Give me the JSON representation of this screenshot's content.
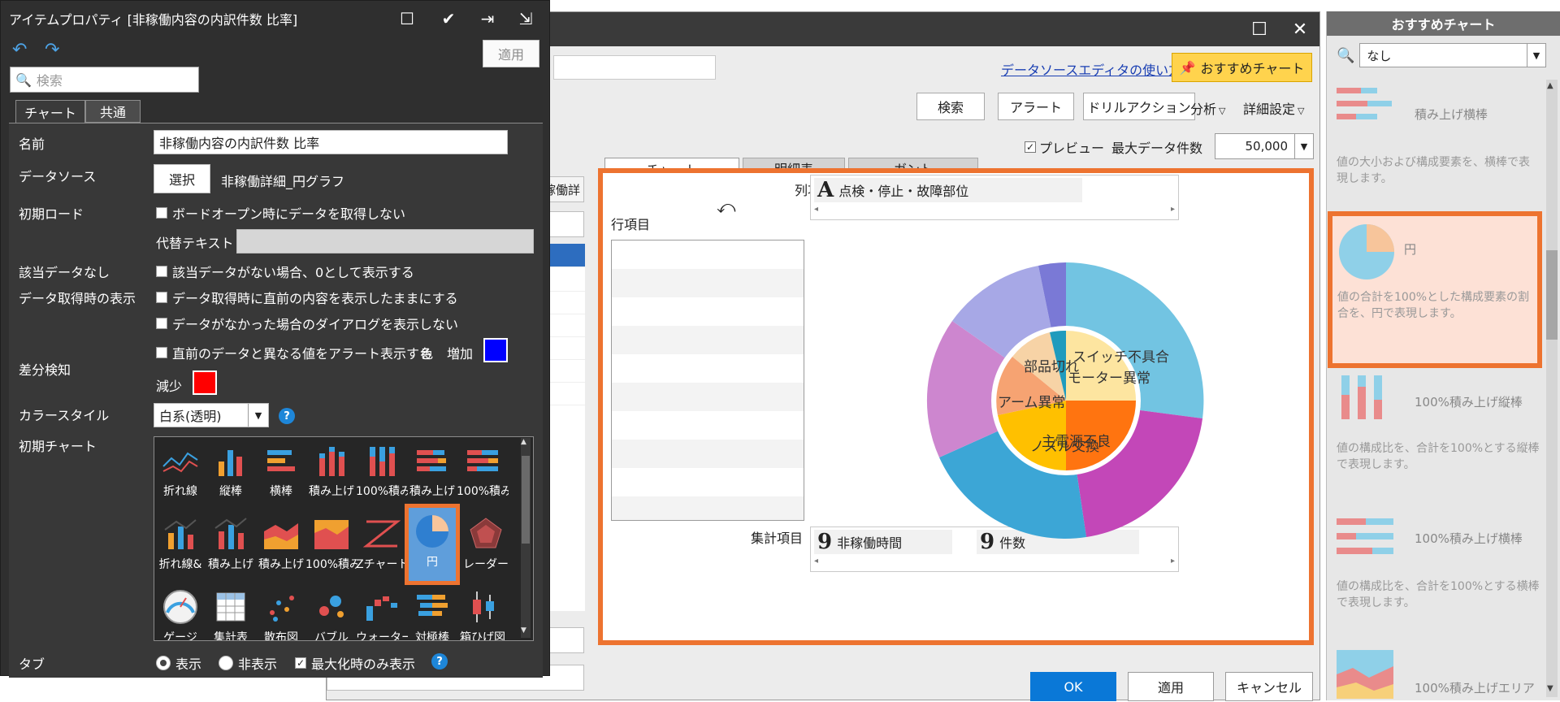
{
  "editor": {
    "help_link": "データソースエディタの使い方",
    "recommend_button": "おすすめチャート",
    "toolbar": {
      "search": "検索",
      "alert": "アラート",
      "drill_action": "ドリルアクション",
      "analysis": "分析",
      "detail_settings": "詳細設定"
    },
    "preview_label": "プレビュー",
    "max_count_label": "最大データ件数",
    "max_count_value": "50,000",
    "left_partial_text": "稼働詳",
    "tabs": [
      "チャート",
      "明細表",
      "ガント"
    ],
    "col_item_label": "列項目",
    "row_item_label": "行項目",
    "agg_item_label": "集計項目",
    "col_field": "点検・停止・故障部位",
    "agg_fields": [
      "非稼働時間",
      "件数"
    ],
    "pie_labels": {
      "switch": "スイッチ不具合",
      "parts": "部品切れ",
      "motor": "モーター異常",
      "arm": "アーム異常",
      "main": "主電源不良",
      "nozzle": "ノズル交換"
    },
    "footer": {
      "ok": "OK",
      "apply": "適用",
      "cancel": "キャンセル"
    },
    "colors": {
      "accent_orange": "#ed7330",
      "ok_blue": "#0a78d7"
    }
  },
  "recommend": {
    "title": "おすすめチャート",
    "search_value": "なし",
    "items": [
      {
        "name": "積み上げ横棒",
        "desc": "値の大小および構成要素を、横棒で表現します。"
      },
      {
        "name": "円",
        "desc": "値の合計を100%とした構成要素の割合を、円で表現します。"
      },
      {
        "name": "100%積み上げ縦棒",
        "desc": "値の構成比を、合計を100%とする縦棒で表現します。"
      },
      {
        "name": "100%積み上げ横棒",
        "desc": "値の構成比を、合計を100%とする横棒で表現します。"
      },
      {
        "name": "100%積み上げエリア",
        "desc": ""
      }
    ]
  },
  "props": {
    "title": "アイテムプロパティ [非稼働内容の内訳件数 比率]",
    "apply": "適用",
    "search_placeholder": "検索",
    "tabs": [
      "チャート",
      "共通"
    ],
    "name_label": "名前",
    "name_value": "非稼働内容の内訳件数 比率",
    "datasource_label": "データソース",
    "select_button": "選択",
    "datasource_value": "非稼働詳細_円グラフ",
    "initial_load_label": "初期ロード",
    "initial_load_check": "ボードオープン時にデータを取得しない",
    "alt_text_label": "代替テキスト",
    "nodata_label": "該当データなし",
    "nodata_check": "該当データがない場合、0として表示する",
    "fetch_display_label": "データ取得時の表示",
    "fetch_check1": "データ取得時に直前の内容を表示したままにする",
    "fetch_check2": "データがなかった場合のダイアログを表示しない",
    "diff_label": "差分検知",
    "diff_check": "直前のデータと異なる値をアラート表示する",
    "color_label": "色",
    "increase_label": "増加",
    "decrease_label": "減少",
    "increase_color": "#0000ff",
    "decrease_color": "#ff0000",
    "color_style_label": "カラースタイル",
    "color_style_value": "白系(透明)",
    "initial_chart_label": "初期チャート",
    "chart_types": [
      [
        "折れ線",
        "縦棒",
        "横棒",
        "積み上げ",
        "100%積み",
        "積み上げ",
        "100%積み"
      ],
      [
        "折れ線&",
        "積み上げ",
        "積み上げ",
        "100%積み",
        "Zチャート",
        "円",
        "レーダー"
      ],
      [
        "ゲージ",
        "集計表",
        "散布図",
        "バブル",
        "ウォーター",
        "対極棒",
        "箱ひげ図"
      ]
    ],
    "tab_label": "タブ",
    "tab_show": "表示",
    "tab_hide": "非表示",
    "tab_max_only": "最大化時のみ表示"
  }
}
